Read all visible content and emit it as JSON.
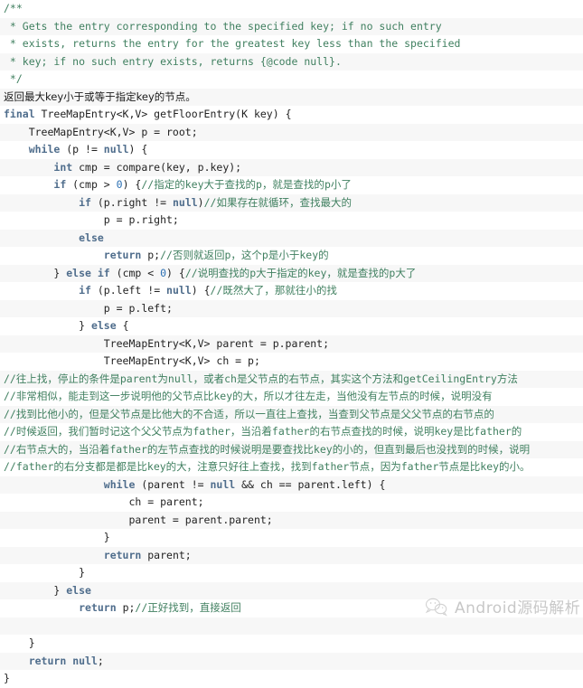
{
  "document": {
    "kind": "code-snippet",
    "language": "Java",
    "method": "getFloorEntry",
    "background_stripe_a": "#ffffff",
    "background_stripe_b": "#f7f7f7",
    "keyword_color": "#4f6d8c",
    "comment_color": "#3f7f5f",
    "number_color": "#2b6fb3",
    "text_color": "#222222"
  },
  "watermark": {
    "icon": "wechat-logo-icon",
    "text": "Android源码解析"
  },
  "code": {
    "lines": [
      "/**",
      " * Gets the entry corresponding to the specified key; if no such entry",
      " * exists, returns the entry for the greatest key less than the specified",
      " * key; if no such entry exists, returns {@code null}.",
      " */",
      "返回最大key小于或等于指定key的节点。",
      "final TreeMapEntry<K,V> getFloorEntry(K key) {",
      "    TreeMapEntry<K,V> p = root;",
      "    while (p != null) {",
      "        int cmp = compare(key, p.key);",
      "        if (cmp > 0) {//指定的key大于查找的p，就是查找的p小了",
      "            if (p.right != null)//如果存在就循环，查找最大的",
      "                p = p.right;",
      "            else",
      "                return p;//否则就返回p，这个p是小于key的",
      "        } else if (cmp < 0) {//说明查找的p大于指定的key，就是查找的p大了",
      "            if (p.left != null) {//既然大了，那就往小的找",
      "                p = p.left;",
      "            } else {",
      "                TreeMapEntry<K,V> parent = p.parent;",
      "                TreeMapEntry<K,V> ch = p;",
      "//往上找，停止的条件是parent为null，或者ch是父节点的右节点，其实这个方法和getCeilingEntry方法",
      "//非常相似，能走到这一步说明他的父节点比key的大，所以才往左走，当他没有左节点的时候，说明没有",
      "//找到比他小的，但是父节点是比他大的不合适，所以一直往上查找，当查到父节点是父父节点的右节点的",
      "//时候返回，我们暂时记这个父父节点为father，当沿着father的右节点查找的时候，说明key是比father的",
      "//右节点大的，当沿着father的左节点查找的时候说明是要查找比key的小的，但直到最后也没找到的时候，说明",
      "//father的右分支都是都是比key的大，注意只好往上查找，找到father节点，因为father节点是比key的小。",
      "                while (parent != null && ch == parent.left) {",
      "                    ch = parent;",
      "                    parent = parent.parent;",
      "                }",
      "                return parent;",
      "            }",
      "        } else",
      "            return p;//正好找到，直接返回",
      "",
      "    }",
      "    return null;",
      "}"
    ],
    "html_lines": [
      "<span class=\"tok-cm\">/**</span>",
      "<span class=\"tok-cm\"> * Gets the entry corresponding to the specified key; if no such entry</span>",
      "<span class=\"tok-cm\"> * exists, returns the entry for the greatest key less than the specified</span>",
      "<span class=\"tok-cm\"> * key; if no such entry exists, returns {@code null}.</span>",
      "<span class=\"tok-cm\"> */</span>",
      "<span class=\"cn tok-zh\">返回最大key小于或等于指定key的节点。</span>",
      "<span class=\"tok-kw\">final</span> TreeMapEntry&lt;K,V&gt; getFloorEntry(K key) {",
      "    TreeMapEntry&lt;K,V&gt; p = root;",
      "    <span class=\"tok-kw\">while</span> (p != <span class=\"tok-kw\">null</span>) {",
      "        <span class=\"tok-kw\">int</span> cmp = compare(key, p.key);",
      "        <span class=\"tok-kw\">if</span> (cmp &gt; <span class=\"tok-num\">0</span>) {<span class=\"tok-cm\">//</span><span class=\"cn tok-cm\">指定的</span><span class=\"tok-cm\">key</span><span class=\"cn tok-cm\">大于查找的</span><span class=\"tok-cm\">p</span><span class=\"cn tok-cm\">，就是查找的</span><span class=\"tok-cm\">p</span><span class=\"cn tok-cm\">小了</span>",
      "            <span class=\"tok-kw\">if</span> (p.right != <span class=\"tok-kw\">null</span>)<span class=\"tok-cm\">//</span><span class=\"cn tok-cm\">如果存在就循环，查找最大的</span>",
      "                p = p.right;",
      "            <span class=\"tok-kw\">else</span>",
      "                <span class=\"tok-kw\">return</span> p;<span class=\"tok-cm\">//</span><span class=\"cn tok-cm\">否则就返回</span><span class=\"tok-cm\">p</span><span class=\"cn tok-cm\">，这个</span><span class=\"tok-cm\">p</span><span class=\"cn tok-cm\">是小于</span><span class=\"tok-cm\">key</span><span class=\"cn tok-cm\">的</span>",
      "        } <span class=\"tok-kw\">else if</span> (cmp &lt; <span class=\"tok-num\">0</span>) {<span class=\"tok-cm\">//</span><span class=\"cn tok-cm\">说明查找的</span><span class=\"tok-cm\">p</span><span class=\"cn tok-cm\">大于指定的</span><span class=\"tok-cm\">key</span><span class=\"cn tok-cm\">，就是查找的</span><span class=\"tok-cm\">p</span><span class=\"cn tok-cm\">大了</span>",
      "            <span class=\"tok-kw\">if</span> (p.left != <span class=\"tok-kw\">null</span>) {<span class=\"tok-cm\">//</span><span class=\"cn tok-cm\">既然大了，那就往小的找</span>",
      "                p = p.left;",
      "            } <span class=\"tok-kw\">else</span> {",
      "                TreeMapEntry&lt;K,V&gt; parent = p.parent;",
      "                TreeMapEntry&lt;K,V&gt; ch = p;",
      "<span class=\"tok-cm\">//</span><span class=\"cn tok-cm\">往上找，停止的条件是</span><span class=\"tok-cm\">parent</span><span class=\"cn tok-cm\">为</span><span class=\"tok-cm\">null</span><span class=\"cn tok-cm\">，或者</span><span class=\"tok-cm\">ch</span><span class=\"cn tok-cm\">是父节点的右节点，其实这个方法和</span><span class=\"tok-cm\">getCeilingEntry</span><span class=\"cn tok-cm\">方法</span>",
      "<span class=\"tok-cm\">//</span><span class=\"cn tok-cm\">非常相似，能走到这一步说明他的父节点比</span><span class=\"tok-cm\">key</span><span class=\"cn tok-cm\">的大，所以才往左走，当他没有左节点的时候，说明没有</span>",
      "<span class=\"tok-cm\">//</span><span class=\"cn tok-cm\">找到比他小的，但是父节点是比他大的不合适，所以一直往上查找，当查到父节点是父父节点的右节点的</span>",
      "<span class=\"tok-cm\">//</span><span class=\"cn tok-cm\">时候返回，我们暂时记这个父父节点为</span><span class=\"tok-cm\">father</span><span class=\"cn tok-cm\">，当沿着</span><span class=\"tok-cm\">father</span><span class=\"cn tok-cm\">的右节点查找的时候，说明</span><span class=\"tok-cm\">key</span><span class=\"cn tok-cm\">是比</span><span class=\"tok-cm\">father</span><span class=\"cn tok-cm\">的</span>",
      "<span class=\"tok-cm\">//</span><span class=\"cn tok-cm\">右节点大的，当沿着</span><span class=\"tok-cm\">father</span><span class=\"cn tok-cm\">的左节点查找的时候说明是要查找比</span><span class=\"tok-cm\">key</span><span class=\"cn tok-cm\">的小的，但直到最后也没找到的时候，说明</span>",
      "<span class=\"tok-cm\">//father</span><span class=\"cn tok-cm\">的右分支都是都是比</span><span class=\"tok-cm\">key</span><span class=\"cn tok-cm\">的大，注意只好往上查找，找到</span><span class=\"tok-cm\">father</span><span class=\"cn tok-cm\">节点，因为</span><span class=\"tok-cm\">father</span><span class=\"cn tok-cm\">节点是比</span><span class=\"tok-cm\">key</span><span class=\"cn tok-cm\">的小。</span>",
      "                <span class=\"tok-kw\">while</span> (parent != <span class=\"tok-kw\">null</span> &amp;&amp; ch == parent.left) {",
      "                    ch = parent;",
      "                    parent = parent.parent;",
      "                }",
      "                <span class=\"tok-kw\">return</span> parent;",
      "            }",
      "        } <span class=\"tok-kw\">else</span>",
      "            <span class=\"tok-kw\">return</span> p;<span class=\"tok-cm\">//</span><span class=\"cn tok-cm\">正好找到，直接返回</span>",
      "",
      "    }",
      "    <span class=\"tok-kw\">return</span> <span class=\"tok-kw\">null</span>;",
      "}"
    ]
  }
}
